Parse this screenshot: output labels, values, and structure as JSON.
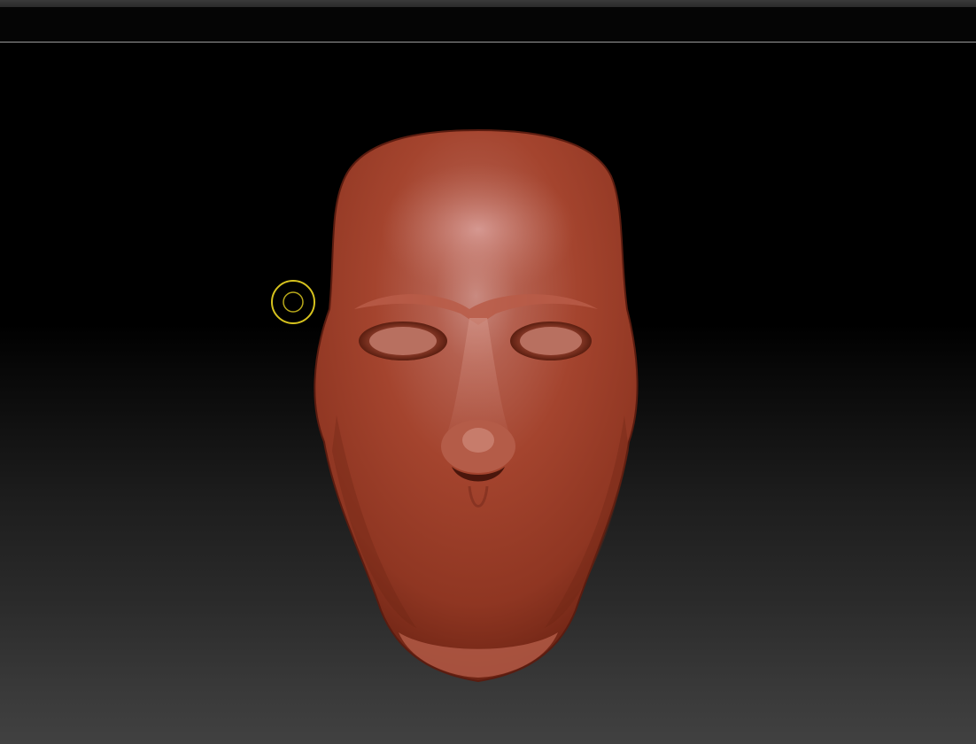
{
  "app": {
    "toolbar": {},
    "viewport": {
      "model": {
        "subject": "sculpted-head",
        "material_color": "#a8422c"
      },
      "brush_cursor": {
        "color": "#d6c21e"
      }
    }
  }
}
